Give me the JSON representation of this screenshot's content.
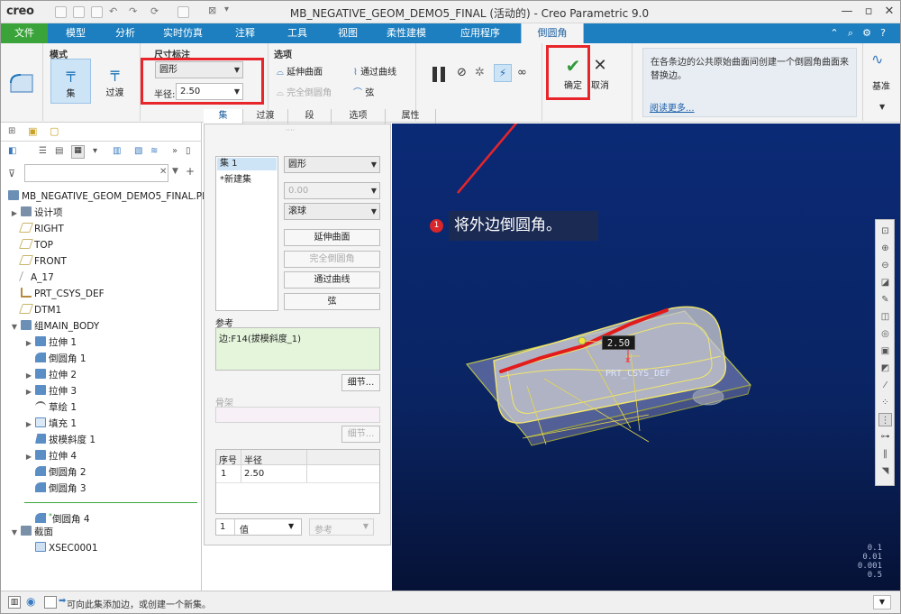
{
  "app": {
    "logo": "creo",
    "window_title": "MB_NEGATIVE_GEOM_DEMO5_FINAL (活动的) - Creo Parametric 9.0"
  },
  "ribbon_tabs": {
    "file": "文件",
    "tabs": [
      "模型",
      "分析",
      "实时仿真",
      "注释",
      "工具",
      "视图",
      "柔性建模",
      "应用程序"
    ],
    "active": "倒圆角"
  },
  "ribbon": {
    "mode_group": "模式",
    "mode_set": "集",
    "mode_transition": "过渡",
    "dim_group": "尺寸标注",
    "shape_value": "圆形",
    "radius_label": "半径:",
    "radius_value": "2.50",
    "options_group": "选项",
    "opt_extend": "延伸曲面",
    "opt_full_round": "完全倒圆角",
    "opt_through_curve": "通过曲线",
    "opt_chord": "弦",
    "ok_label": "确定",
    "cancel_label": "取消",
    "info_text": "在各条边的公共原始曲面间创建一个倒圆角曲面来替换边。",
    "read_more": "阅读更多...",
    "datum_label": "基准"
  },
  "sub_tabs": [
    "集",
    "过渡",
    "段",
    "选项",
    "属性"
  ],
  "tree": {
    "root": "MB_NEGATIVE_GEOM_DEMO5_FINAL.PR",
    "items": [
      {
        "label": "设计项",
        "color": "#7a8fa8"
      },
      {
        "label": "RIGHT",
        "color": "#c9b56a"
      },
      {
        "label": "TOP",
        "color": "#c9b56a"
      },
      {
        "label": "FRONT",
        "color": "#c9b56a"
      },
      {
        "label": "A_17",
        "color": "#888888"
      },
      {
        "label": "PRT_CSYS_DEF",
        "color": "#b58a3c"
      },
      {
        "label": "DTM1",
        "color": "#c9b56a"
      },
      {
        "label": "组MAIN_BODY",
        "color": "#6b8fb5"
      },
      {
        "label": "拉伸 1",
        "color": "#5b8ec4"
      },
      {
        "label": "倒圆角 1",
        "color": "#5b8ec4"
      },
      {
        "label": "拉伸 2",
        "color": "#5b8ec4"
      },
      {
        "label": "拉伸 3",
        "color": "#5b8ec4"
      },
      {
        "label": "草绘 1",
        "color": "#6a6a6a"
      },
      {
        "label": "填充 1",
        "color": "#5b8ec4"
      },
      {
        "label": "拔模斜度 1",
        "color": "#5b8ec4"
      },
      {
        "label": "拉伸 4",
        "color": "#5b8ec4"
      },
      {
        "label": "倒圆角 2",
        "color": "#5b8ec4"
      },
      {
        "label": "倒圆角 3",
        "color": "#5b8ec4"
      },
      {
        "label": "倒圆角 4",
        "color": "#5b8ec4"
      },
      {
        "label": "截面",
        "color": "#7a8fa8"
      },
      {
        "label": "XSEC0001",
        "color": "#5b8ec4"
      }
    ]
  },
  "set_panel": {
    "set1": "集 1",
    "new_set": "*新建集",
    "shape": "圆形",
    "value": "0.00",
    "method": "滚球",
    "btn_extend": "延伸曲面",
    "btn_full_round": "完全倒圆角",
    "btn_through_curve": "通过曲线",
    "btn_chord": "弦",
    "ref_label": "参考",
    "ref_value": "边:F14(拔模斜度_1)",
    "details": "细节...",
    "skeleton_label": "骨架",
    "col_index": "序号",
    "col_radius": "半径",
    "row_index": "1",
    "row_radius": "2.50",
    "bottom_num": "1",
    "bottom_value": "值",
    "bottom_ref": "参考"
  },
  "viewport": {
    "callout_number": "1",
    "callout_text": "将外边倒圆角。",
    "dim_label": "2.50",
    "csys_label": "PRT_CSYS_DEF",
    "scale_lines": [
      "0.1",
      "0.01",
      "0.001",
      "0.5"
    ]
  },
  "status": {
    "message": "可向此集添加边，或创建一个新集。"
  },
  "colors": {
    "accent": "#1d7fc0",
    "file_tab": "#3aa43a",
    "highlight": "#e8252a",
    "edge_highlight": "#e31b1b",
    "wire_yellow": "#f2e66a"
  }
}
